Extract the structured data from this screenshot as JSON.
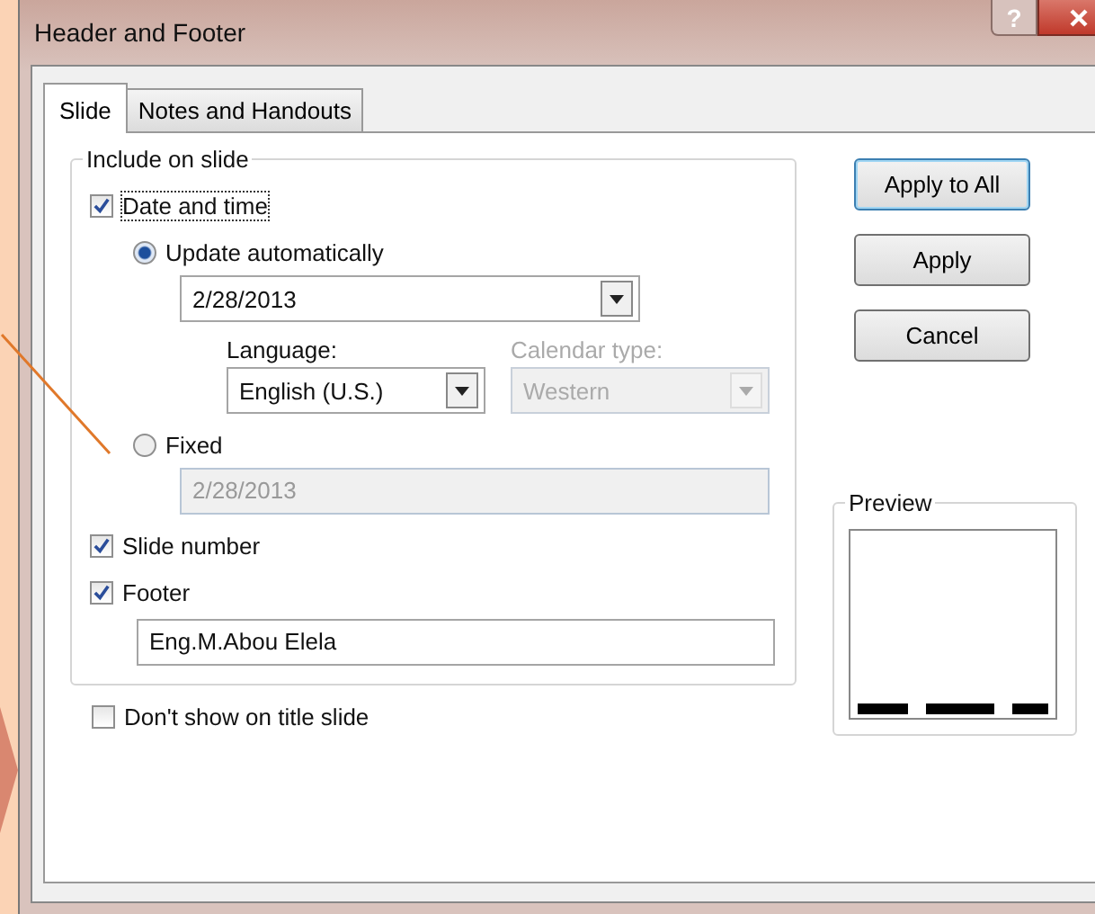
{
  "window": {
    "title": "Header and Footer",
    "help": "?"
  },
  "tabs": [
    {
      "label": "Slide",
      "selected": true
    },
    {
      "label": "Notes and Handouts",
      "selected": false
    }
  ],
  "include_on_slide": {
    "title": "Include on slide",
    "date_and_time": {
      "label": "Date and time",
      "checked": true
    },
    "date_modes": [
      {
        "label": "Update automatically",
        "selected": true
      },
      {
        "label": "Fixed",
        "selected": false
      }
    ],
    "date_format": {
      "value": "2/28/2013",
      "disabled": false
    },
    "language": {
      "label": "Language:",
      "value": "English (U.S.)",
      "disabled": false
    },
    "calendar_type": {
      "label": "Calendar type:",
      "value": "Western",
      "disabled": true
    },
    "fixed_date": {
      "value": "2/28/2013",
      "disabled": true
    },
    "slide_number": {
      "label": "Slide number",
      "checked": true
    },
    "footer": {
      "label": "Footer",
      "checked": true
    },
    "footer_text": {
      "value": "Eng.M.Abou Elela"
    }
  },
  "dont_show_on_title_slide": {
    "label": "Don't show on title slide",
    "checked": false
  },
  "buttons": [
    {
      "label": "Apply to All",
      "default": true
    },
    {
      "label": "Apply",
      "default": false
    },
    {
      "label": "Cancel",
      "default": false
    }
  ],
  "preview": {
    "title": "Preview"
  }
}
